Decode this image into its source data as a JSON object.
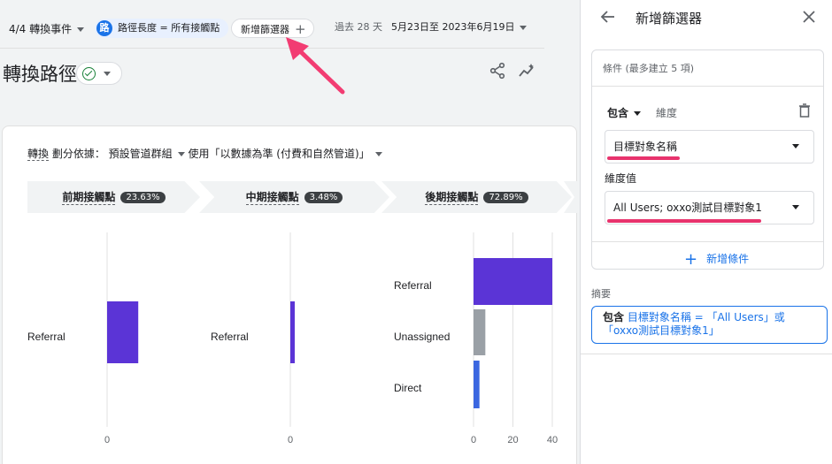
{
  "header": {
    "events_label": "4/4 轉換事件",
    "path_badge": "路",
    "path_chip": "路徑長度 = 所有接觸點",
    "add_filter": "新增篩選器",
    "date_prefix": "過去 28 天",
    "date_range": "5月23日至 2023年6月19日"
  },
  "page": {
    "title": "轉換路徑"
  },
  "breakdown": {
    "conv": "轉換",
    "text": " 劃分依據： 預設管道群組",
    "model": " 使用「以數據為準 (付費和自然管道)」"
  },
  "stages": [
    {
      "label": "前期接觸點",
      "pct": "23.63%"
    },
    {
      "label": "中期接觸點",
      "pct": "3.48%"
    },
    {
      "label": "後期接觸點",
      "pct": "72.89%"
    }
  ],
  "chart_data": {
    "type": "bar",
    "orientation": "horizontal",
    "panels": [
      {
        "stage": "前期接觸點",
        "categories": [
          "Referral"
        ],
        "values": [
          8
        ],
        "ticks": [
          0
        ]
      },
      {
        "stage": "中期接觸點",
        "categories": [
          "Referral"
        ],
        "values": [
          1
        ],
        "ticks": [
          0
        ]
      },
      {
        "stage": "後期接觸點",
        "categories": [
          "Referral",
          "Unassigned",
          "Direct"
        ],
        "values": [
          40,
          6,
          3
        ],
        "ticks": [
          0,
          20,
          40
        ],
        "xlim": [
          0,
          40
        ]
      }
    ],
    "colors": {
      "Referral": "#5b34d6",
      "Unassigned": "#9aa0a6",
      "Direct": "#3b67e0"
    }
  },
  "panel": {
    "title": "新增篩選器",
    "conditions_header": "條件 (最多建立 5 項)",
    "include_label": "包含",
    "dimension_label": "維度",
    "dimension_value": "目標對象名稱",
    "value_label": "維度值",
    "value_selected": "All Users; oxxo測試目標對象1",
    "add_condition": "新增條件",
    "summary_label": "摘要",
    "summary_prefix": "包含",
    "summary_text": " 目標對象名稱 = 「All Users」或「oxxo測試目標對象1」"
  },
  "colors": {
    "accent": "#1a73e8",
    "highlight": "#e8336d"
  }
}
